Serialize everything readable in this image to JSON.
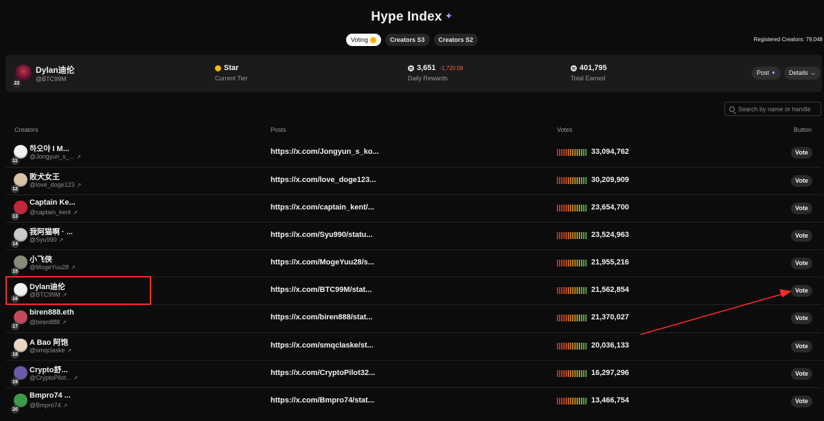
{
  "header": {
    "title": "Hype Index",
    "title_icon": "sparkle-icon",
    "tabs": [
      {
        "label": "Voting",
        "icon": "coin-icon",
        "active": true
      },
      {
        "label": "Creators S3",
        "active": false
      },
      {
        "label": "Creators S2",
        "active": false
      }
    ],
    "registered_label": "Registered Creators:",
    "registered_value": "79,048"
  },
  "profile": {
    "name": "Dylan迪伦",
    "handle": "@BTC99M",
    "rank": "22",
    "tier_value": "Star",
    "tier_label": "Current Tier",
    "daily_value": "3,651",
    "daily_delta": "-1,720.09",
    "daily_label": "Daily Rewards",
    "total_value": "401,795",
    "total_label": "Total Earned",
    "post_label": "Post",
    "details_label": "Details →"
  },
  "search": {
    "placeholder": "Search by name or handle"
  },
  "columns": {
    "creators": "Creators",
    "posts": "Posts",
    "votes": "Votes",
    "button": "Button"
  },
  "rows": [
    {
      "rank": "11",
      "name": "하오야 I M...",
      "handle": "@Jongyun_s_...",
      "post": "https://x.com/Jongyun_s_ko...",
      "votes": "33,094,762",
      "vote_label": "Vote",
      "avatar_color": "#f2f2f2"
    },
    {
      "rank": "12",
      "name": "败犬女王",
      "handle": "@love_doge123",
      "post": "https://x.com/love_doge123...",
      "votes": "30,209,909",
      "vote_label": "Vote",
      "avatar_color": "#d9c3a6"
    },
    {
      "rank": "13",
      "name": "Captain Ke...",
      "handle": "@captain_kent",
      "post": "https://x.com/captain_kent/...",
      "votes": "23,654,700",
      "vote_label": "Vote",
      "avatar_color": "#c8243a"
    },
    {
      "rank": "14",
      "name": "我阿猫啊 · ...",
      "handle": "@Syu990",
      "post": "https://x.com/Syu990/statu...",
      "votes": "23,524,963",
      "vote_label": "Vote",
      "avatar_color": "#c9c9c9"
    },
    {
      "rank": "15",
      "name": "小飞侠",
      "handle": "@MogeYuu28",
      "post": "https://x.com/MogeYuu28/s...",
      "votes": "21,955,216",
      "vote_label": "Vote",
      "avatar_color": "#8a8a7a"
    },
    {
      "rank": "16",
      "name": "Dylan迪伦",
      "handle": "@BTC99M",
      "post": "https://x.com/BTC99M/stat...",
      "votes": "21,562,854",
      "vote_label": "Vote",
      "avatar_color": "#f2f2f2"
    },
    {
      "rank": "17",
      "name": "biren888.eth",
      "handle": "@biren888",
      "post": "https://x.com/biren888/stat...",
      "votes": "21,370,027",
      "vote_label": "Vote",
      "avatar_color": "#c24a5a"
    },
    {
      "rank": "18",
      "name": "A Bao 阿饱",
      "handle": "@smqclaske",
      "post": "https://x.com/smqclaske/st...",
      "votes": "20,036,133",
      "vote_label": "Vote",
      "avatar_color": "#e9d6c2"
    },
    {
      "rank": "19",
      "name": "Crypto舒...",
      "handle": "@CryptoPilot...",
      "post": "https://x.com/CryptoPilot32...",
      "votes": "16,297,296",
      "vote_label": "Vote",
      "avatar_color": "#6a5aa8"
    },
    {
      "rank": "20",
      "name": "Bmpro74 ...",
      "handle": "@Bmpro74",
      "post": "https://x.com/Bmpro74/stat...",
      "votes": "13,466,754",
      "vote_label": "Vote",
      "avatar_color": "#3d9a4a"
    }
  ],
  "colors": {
    "accent": "#b78cff",
    "highlight": "#ff2a2a",
    "negative": "#ff5a4e",
    "coin": "#f5b700"
  }
}
